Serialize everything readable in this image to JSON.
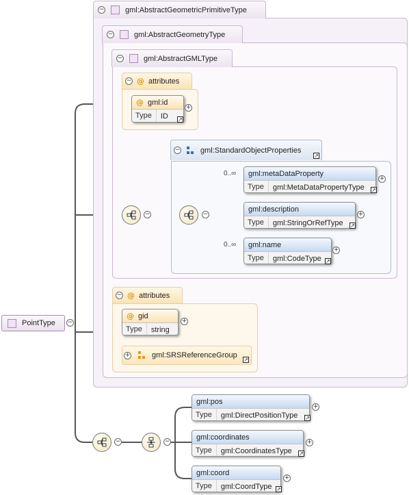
{
  "root": {
    "label": "PointType"
  },
  "types": {
    "primitive": "gml:AbstractGeometricPrimitiveType",
    "geometry": "gml:AbstractGeometryType",
    "gml": "gml:AbstractGMLType"
  },
  "attribute_groups": [
    {
      "label": "attributes",
      "attributes": [
        {
          "name": "gml:id",
          "type_label": "Type",
          "type": "ID"
        }
      ]
    },
    {
      "label": "attributes",
      "attributes": [
        {
          "name": "gid",
          "type_label": "Type",
          "type": "string"
        }
      ],
      "group_ref": "gml:SRSReferenceGroup"
    }
  ],
  "standard_group": {
    "label": "gml:StandardObjectProperties",
    "elements": [
      {
        "occurrence": "0..∞",
        "name": "gml:metaDataProperty",
        "type_label": "Type",
        "type": "gml:MetaDataPropertyType"
      },
      {
        "occurrence": "",
        "name": "gml:description",
        "type_label": "Type",
        "type": "gml:StringOrRefType"
      },
      {
        "occurrence": "0..∞",
        "name": "gml:name",
        "type_label": "Type",
        "type": "gml:CodeType"
      }
    ]
  },
  "choice_elements": [
    {
      "name": "gml:pos",
      "type_label": "Type",
      "type": "gml:DirectPositionType"
    },
    {
      "name": "gml:coordinates",
      "type_label": "Type",
      "type": "gml:CoordinatesType"
    },
    {
      "name": "gml:coord",
      "type_label": "Type",
      "type": "gml:CoordType"
    }
  ],
  "icons": {
    "collapse": "minus-circle-icon",
    "expand": "plus-circle-icon",
    "attribute": "at-sign-icon",
    "sequence": "sequence-compositor-icon",
    "choice": "choice-compositor-icon",
    "reference": "reference-link-icon",
    "group": "element-group-icon",
    "attribute_group": "attribute-group-icon"
  },
  "colors": {
    "type_group_border": "#c9b7cf",
    "type_group_fill": "#f6f1f8",
    "attribute_fill": "#fdf7ec",
    "attribute_accent": "#d69a14",
    "element_header": "#c7daf2",
    "group_icon_blue": "#2f6fb6",
    "group_icon_orange": "#e29b14"
  }
}
